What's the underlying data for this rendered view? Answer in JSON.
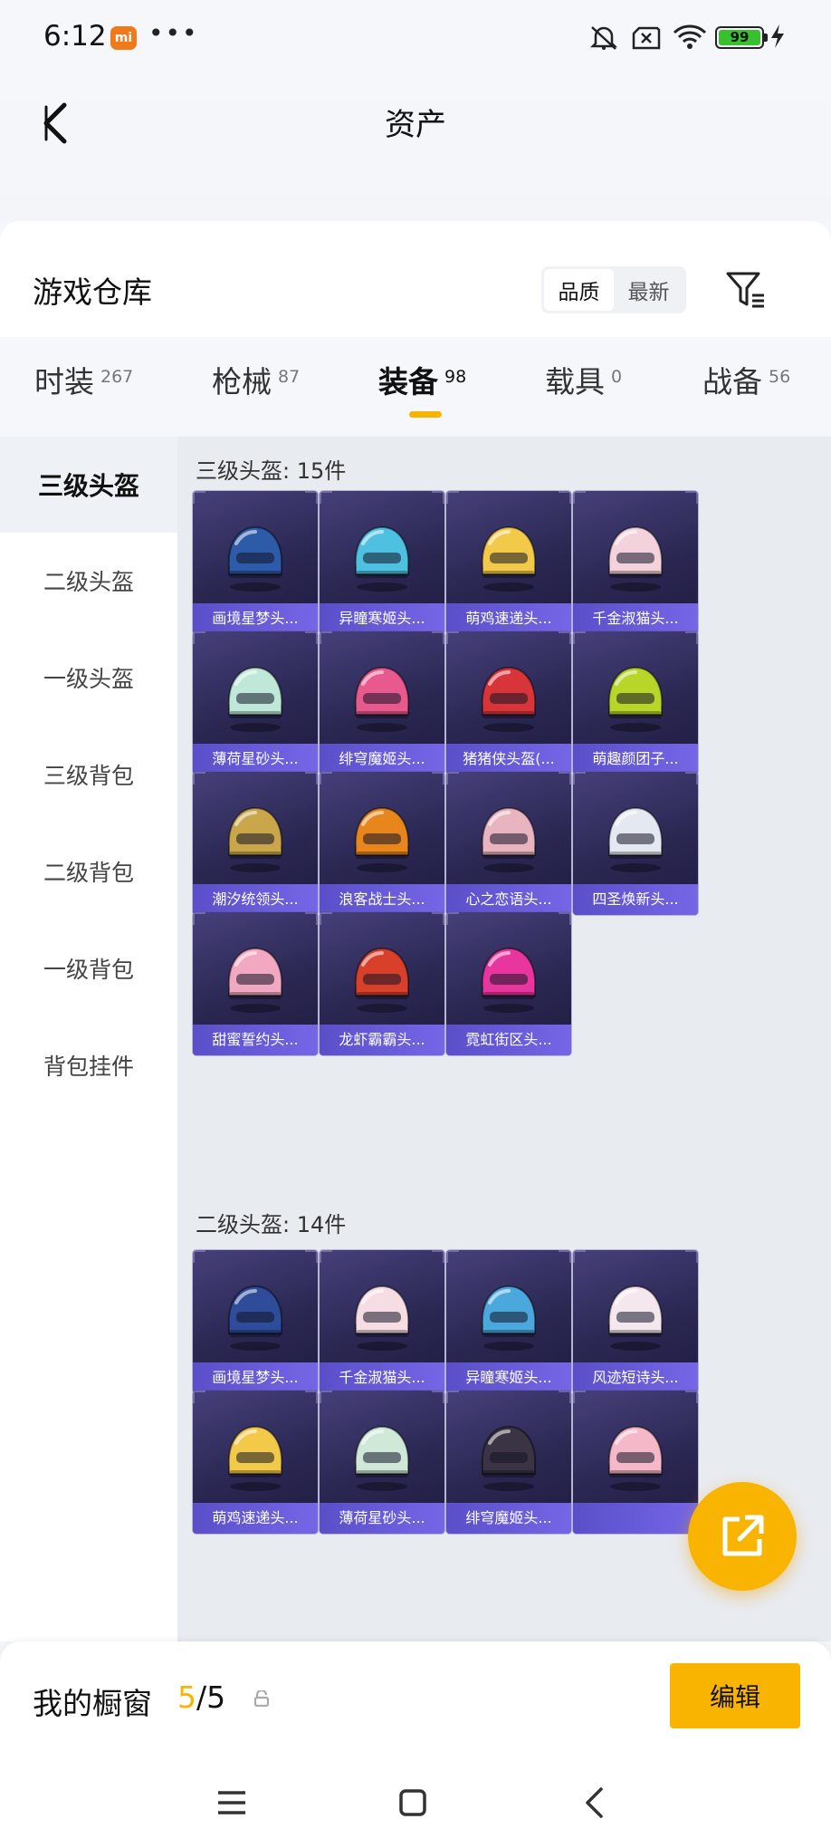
{
  "status_bar": {
    "time": "6:12",
    "mi_badge": "mi",
    "dots": "•••",
    "battery": "99"
  },
  "header": {
    "title": "资产"
  },
  "warehouse": {
    "title": "游戏仓库",
    "sort_options": [
      "品质",
      "最新"
    ],
    "sort_selected": "品质"
  },
  "tabs": [
    {
      "label": "时装",
      "count": "267"
    },
    {
      "label": "枪械",
      "count": "87"
    },
    {
      "label": "装备",
      "count": "98"
    },
    {
      "label": "载具",
      "count": "0"
    },
    {
      "label": "战备",
      "count": "56"
    }
  ],
  "active_tab": "装备",
  "sidebar": {
    "items": [
      "三级头盔",
      "二级头盔",
      "一级头盔",
      "三级背包",
      "二级背包",
      "一级背包",
      "背包挂件"
    ],
    "active": "三级头盔"
  },
  "sections": [
    {
      "title": "三级头盔: 15件",
      "items": [
        {
          "name": "画境星梦头...",
          "icon": "helmet-blue-horned",
          "color": "#2e5ba8"
        },
        {
          "name": "异瞳寒姬头...",
          "icon": "helmet-cyan-crown",
          "color": "#4ec0e0"
        },
        {
          "name": "萌鸡速递头...",
          "icon": "helmet-chick",
          "color": "#f3c94a"
        },
        {
          "name": "千金淑猫头...",
          "icon": "helmet-pink-cat",
          "color": "#f4d2dc"
        },
        {
          "name": "薄荷星砂头...",
          "icon": "helmet-mint",
          "color": "#bfe8d8"
        },
        {
          "name": "绯穹魔姬头...",
          "icon": "helmet-pink-horned",
          "color": "#e85a8e"
        },
        {
          "name": "猪猪侠头盔(...",
          "icon": "helmet-red-visor",
          "color": "#d8353b"
        },
        {
          "name": "萌趣颜团子...",
          "icon": "helmet-green-flower",
          "color": "#b8d62a"
        },
        {
          "name": "潮汐统领头...",
          "icon": "helmet-sea-king",
          "color": "#c9a64a"
        },
        {
          "name": "浪客战士头...",
          "icon": "helmet-ronin",
          "color": "#e8861e"
        },
        {
          "name": "心之恋语头...",
          "icon": "helmet-heart",
          "color": "#e8b4c0"
        },
        {
          "name": "四圣焕新头...",
          "icon": "helmet-white-tiger",
          "color": "#e4e8f0"
        },
        {
          "name": "甜蜜誓约头...",
          "icon": "helmet-sweet-pink",
          "color": "#f2a8c0"
        },
        {
          "name": "龙虾霸霸头...",
          "icon": "helmet-lobster",
          "color": "#d8402a"
        },
        {
          "name": "霓虹街区头...",
          "icon": "helmet-neon",
          "color": "#e8369e"
        }
      ]
    },
    {
      "title": "二级头盔: 14件",
      "items": [
        {
          "name": "画境星梦头...",
          "icon": "helmet-blue-starry",
          "color": "#2e4c9a"
        },
        {
          "name": "千金淑猫头...",
          "icon": "helmet-pink-cat",
          "color": "#f6dde4"
        },
        {
          "name": "异瞳寒姬头...",
          "icon": "helmet-cyan-crown",
          "color": "#4aa8dc"
        },
        {
          "name": "风迹短诗头...",
          "icon": "helmet-white-lace",
          "color": "#f4e8ee"
        },
        {
          "name": "萌鸡速递头...",
          "icon": "helmet-chick",
          "color": "#f3c94a"
        },
        {
          "name": "薄荷星砂头...",
          "icon": "helmet-mint",
          "color": "#cfe8d8"
        },
        {
          "name": "绯穹魔姬头...",
          "icon": "helmet-dark-horned",
          "color": "#3a3444"
        },
        {
          "name": "",
          "icon": "helmet-pink-bow",
          "color": "#f4b8c8"
        }
      ]
    }
  ],
  "fab": {
    "icon": "share-out-icon"
  },
  "showcase": {
    "label": "我的橱窗",
    "current": "5",
    "total": "/5",
    "edit_label": "编辑"
  },
  "nav": {
    "icons": [
      "menu-icon",
      "home-icon",
      "back-icon"
    ]
  },
  "colors": {
    "accent": "#f8b400",
    "card_label": "#5a4fc9"
  }
}
